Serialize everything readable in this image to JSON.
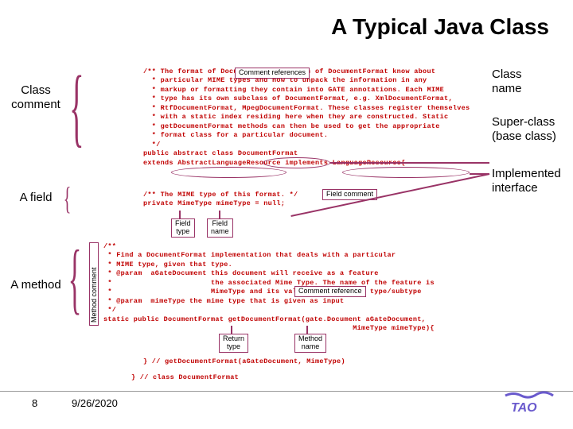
{
  "title": "A Typical Java Class",
  "left_labels": {
    "class_comment": "Class\ncomment",
    "field": "A field",
    "method": "A method"
  },
  "right_labels": {
    "class_name": "Class\nname",
    "super_class": "Super-class\n(base class)",
    "interface": "Implemented\ninterface"
  },
  "tags": {
    "comment_refs_top": "Comment references",
    "field_comment": "Field comment",
    "field_type": "Field\ntype",
    "field_name": "Field\nname",
    "comment_refs_mid": "Comment reference",
    "return_type": "Return\ntype",
    "method_name": "Method\nname",
    "method_comment": "Method comment"
  },
  "code": {
    "class_comment": "/** The format of Documents. Subclasses of DocumentFormat know about\n  * particular MIME types and how to unpack the information in any\n  * markup or formatting they contain into GATE annotations. Each MIME\n  * type has its own subclass of DocumentFormat, e.g. XmlDocumentFormat,\n  * RtfDocumentFormat, MpegDocumentFormat. These classes register themselves\n  * with a static index residing here when they are constructed. Static\n  * getDocumentFormat methods can then be used to get the appropriate\n  * format class for a particular document.\n  */\npublic abstract class DocumentFormat\nextends AbstractLanguageResource implements LanguageResource{",
    "field_line": "/** The MIME type of this format. */\nprivate MimeType mimeType = null;",
    "method_comment_code": "/**\n * Find a DocumentFormat implementation that deals with a particular\n * MIME type, given that type.\n * @param  aGateDocument this document will receive as a feature\n *                       the associated Mime Type. The name of the feature is\n *                       MimeType and its value is the format type/subtype\n * @param  mimeType the mime type that is given as input\n */\nstatic public DocumentFormat getDocumentFormat(gate.Document aGateDocument,\n                                                          MimeType mimeType){",
    "method_close": "} // getDocumentFormat(aGateDocument, MimeType)",
    "class_close": "} // class DocumentFormat"
  },
  "footer": {
    "page": "8",
    "date": "9/26/2020",
    "logo": "TAO"
  }
}
